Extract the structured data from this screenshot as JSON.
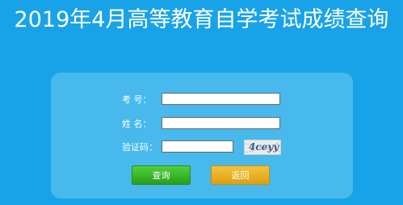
{
  "page": {
    "title": "2019年4月高等教育自学考试成绩查询"
  },
  "form": {
    "exam_number_label": "考  号：",
    "exam_number_value": "",
    "name_label": "姓  名：",
    "name_value": "",
    "captcha_label": "验证码：",
    "captcha_value": "",
    "captcha_text": "4ceyy",
    "query_button": "查询",
    "back_button": "返回"
  },
  "colors": {
    "background": "#18a3e8",
    "panel": "#47b9ec",
    "query_button": "#3cb829",
    "back_button": "#e8b222"
  }
}
